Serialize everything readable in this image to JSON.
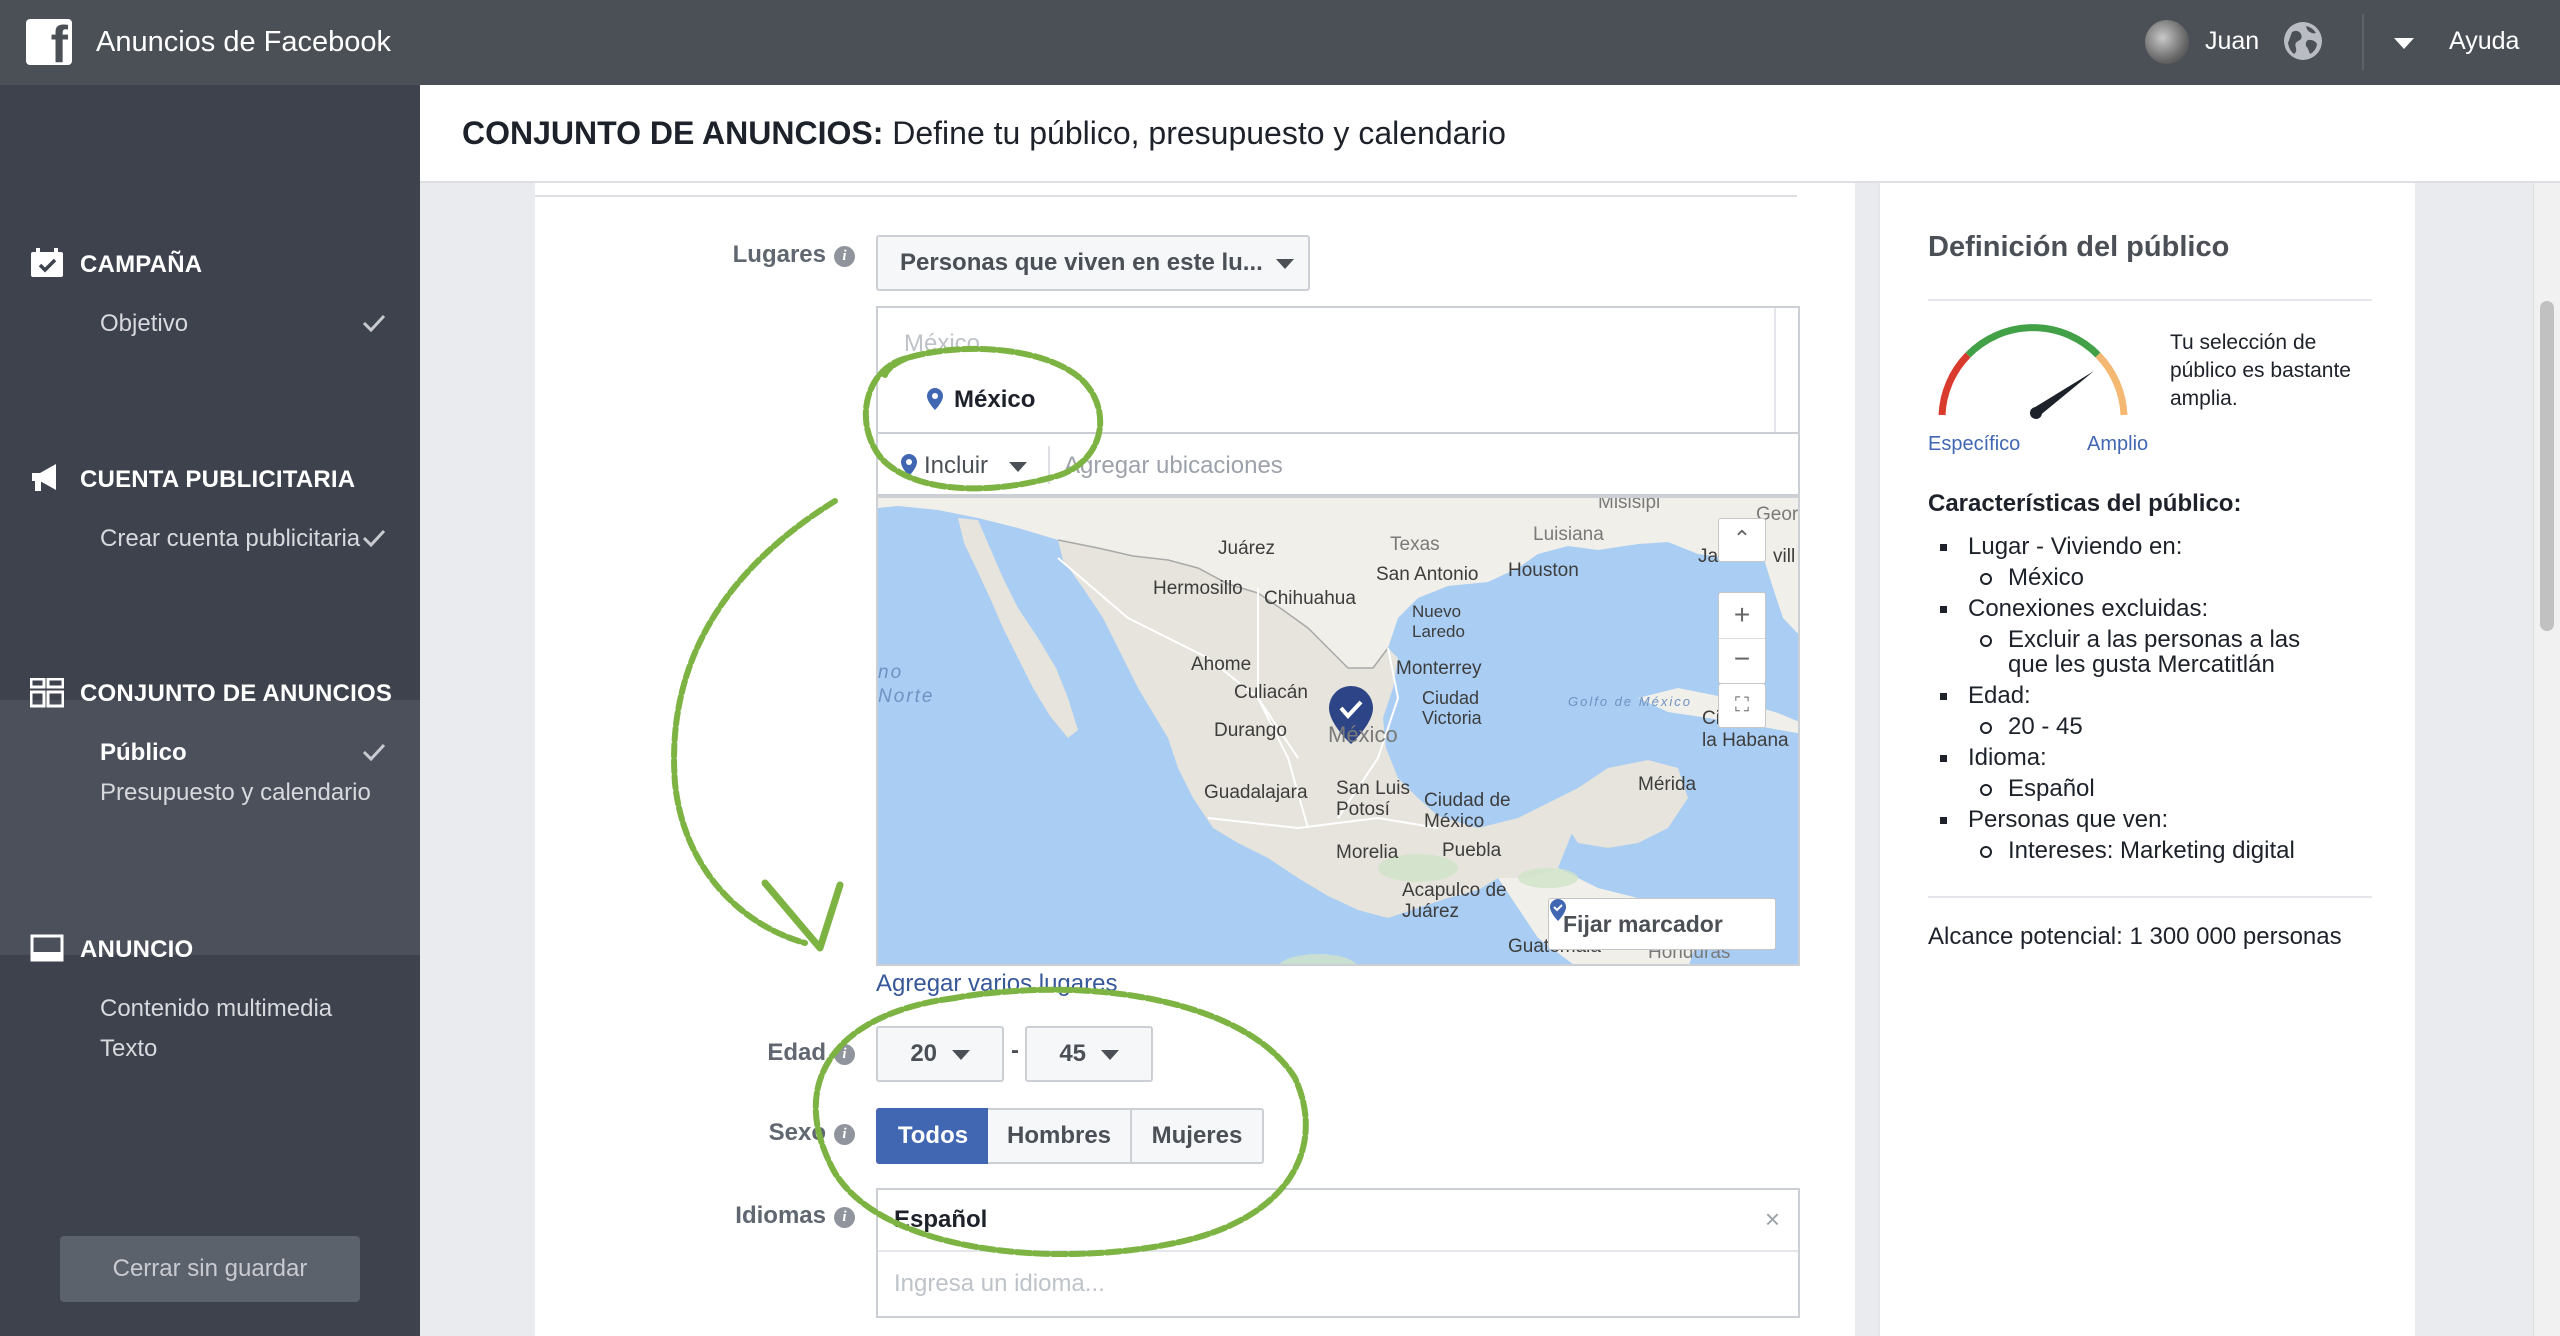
{
  "topbar": {
    "app_title": "Anuncios de Facebook",
    "user_name": "Juan",
    "help_label": "Ayuda"
  },
  "sidebar": {
    "sections": [
      {
        "title": "CAMPAÑA",
        "icon": "calendar-check-icon",
        "items": [
          {
            "label": "Objetivo",
            "done": true
          }
        ]
      },
      {
        "title": "CUENTA PUBLICITARIA",
        "icon": "megaphone-icon",
        "items": [
          {
            "label": "Crear cuenta publicitaria",
            "done": true
          }
        ]
      },
      {
        "title": "CONJUNTO DE ANUNCIOS",
        "icon": "grid-icon",
        "items": [
          {
            "label": "Público",
            "done": true,
            "active": true
          },
          {
            "label": "Presupuesto y calendario",
            "done": false
          }
        ]
      },
      {
        "title": "ANUNCIO",
        "icon": "monitor-icon",
        "items": [
          {
            "label": "Contenido multimedia",
            "done": false
          },
          {
            "label": "Texto",
            "done": false
          }
        ]
      }
    ],
    "close_button": "Cerrar sin guardar"
  },
  "header": {
    "title_bold": "CONJUNTO DE ANUNCIOS:",
    "title_rest": "Define tu público, presupuesto y calendario"
  },
  "form": {
    "locations": {
      "label": "Lugares",
      "select_value": "Personas que viven en este lu...",
      "ghost_text": "México",
      "selected_location": "México",
      "include_label": "Incluir",
      "add_placeholder": "Agregar ubicaciones",
      "add_multiple": "Agregar varios lugares",
      "fix_marker": "Fijar marcador",
      "map_labels": {
        "juarez": "Juárez",
        "texas": "Texas",
        "luisiana": "Luisiana",
        "misisipi": "Misisipi",
        "georgia": "Georg",
        "jacksonville": "Ja",
        "vill": "vill",
        "hermosillo": "Hermosillo",
        "chihuahua": "Chihuahua",
        "san_antonio": "San Antonio",
        "houston": "Houston",
        "nuevo_laredo": "Nuevo\nLaredo",
        "ahome": "Ahome",
        "monterrey": "Monterrey",
        "culiacan": "Culiacán",
        "ciudad_victoria": "Ciudad\nVictoria",
        "durango": "Durango",
        "mexico": "México",
        "golfo": "Golfo de México",
        "la_habana": "Ci    de\nla Habana",
        "norte": "Norte",
        "oceano": "no",
        "merida": "Mérida",
        "guadalajara": "Guadalajara",
        "san_luis": "San Luis\nPotosí",
        "ciudad_mexico": "Ciudad de\nMéxico",
        "morelia": "Morelia",
        "puebla": "Puebla",
        "acapulco": "Acapulco de\nJuárez",
        "guatemala": "Guatemala",
        "honduras": "Honduras"
      }
    },
    "age": {
      "label": "Edad",
      "min": "20",
      "max": "45",
      "dash": "-"
    },
    "gender": {
      "label": "Sexo",
      "options": [
        "Todos",
        "Hombres",
        "Mujeres"
      ],
      "selected": "Todos"
    },
    "languages": {
      "label": "Idiomas",
      "selected": "Español",
      "placeholder": "Ingresa un idioma..."
    }
  },
  "audience": {
    "title": "Definición del público",
    "gauge_desc": "Tu selección de público es bastante amplia.",
    "gauge_left": "Específico",
    "gauge_right": "Amplio",
    "characteristics_title": "Características del público:",
    "items": [
      {
        "label": "Lugar - Viviendo en:",
        "sub": [
          "México"
        ]
      },
      {
        "label": "Conexiones excluidas:",
        "sub": [
          "Excluir a las personas a las que les gusta Mercatitlán"
        ]
      },
      {
        "label": "Edad:",
        "sub": [
          "20 - 45"
        ]
      },
      {
        "label": "Idioma:",
        "sub": [
          "Español"
        ]
      },
      {
        "label": "Personas que ven:",
        "sub": [
          "Intereses: Marketing digital"
        ]
      }
    ],
    "reach": "Alcance potencial: 1 300 000 personas"
  },
  "colors": {
    "topbar": "#4b4f56",
    "sidebar": "#3d424d",
    "accent_blue": "#4267b2",
    "link_blue": "#365899",
    "annotation_green": "#7cb342"
  }
}
